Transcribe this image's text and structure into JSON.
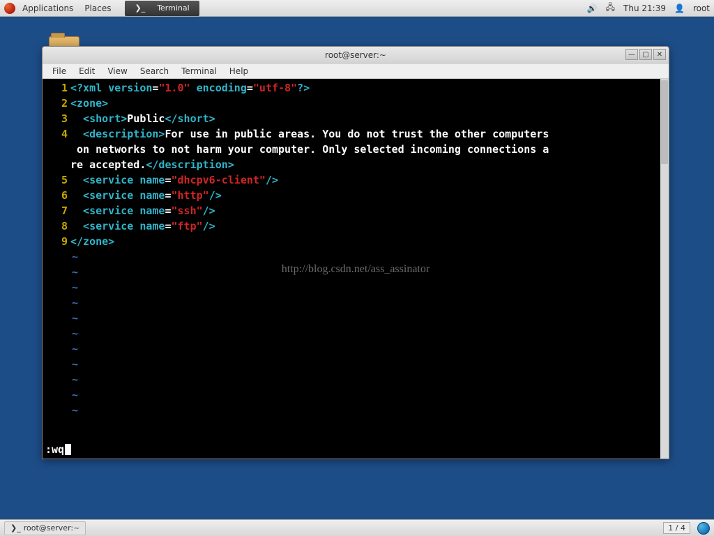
{
  "panel": {
    "apps": "Applications",
    "places": "Places",
    "active_app": "Terminal",
    "time": "Thu 21:39",
    "user": "root"
  },
  "window": {
    "title": "root@server:~",
    "menu": {
      "file": "File",
      "edit": "Edit",
      "view": "View",
      "search": "Search",
      "terminal": "Terminal",
      "help": "Help"
    }
  },
  "editor": {
    "line_numbers": [
      "1",
      "2",
      "3",
      "4",
      " ",
      " ",
      "5",
      "6",
      "7",
      "8",
      "9"
    ],
    "xml": {
      "decl_open": "<?xml ",
      "version_key": "version",
      "version_val": "\"1.0\"",
      "encoding_key": " encoding",
      "encoding_val": "\"utf-8\"",
      "decl_close": "?>",
      "zone_open": "<zone>",
      "short_open": "  <short>",
      "short_text": "Public",
      "short_close": "</short>",
      "desc_open": "  <description>",
      "desc_l1": "For use in public areas. You do not trust the other computers",
      "desc_l2": " on networks to not harm your computer. Only selected incoming connections a",
      "desc_l3": "re accepted.",
      "desc_close": "</description>",
      "svc_open": "  <service ",
      "name_key": "name",
      "svc1": "\"dhcpv6-client\"",
      "svc2": "\"http\"",
      "svc3": "\"ssh\"",
      "svc4": "\"ftp\"",
      "svc_close": "/>",
      "zone_close": "</zone>"
    },
    "tilde": "~",
    "watermark": "http://blog.csdn.net/ass_assinator",
    "command": ":wq"
  },
  "taskbar": {
    "task": "root@server:~",
    "workspace": "1 / 4"
  }
}
